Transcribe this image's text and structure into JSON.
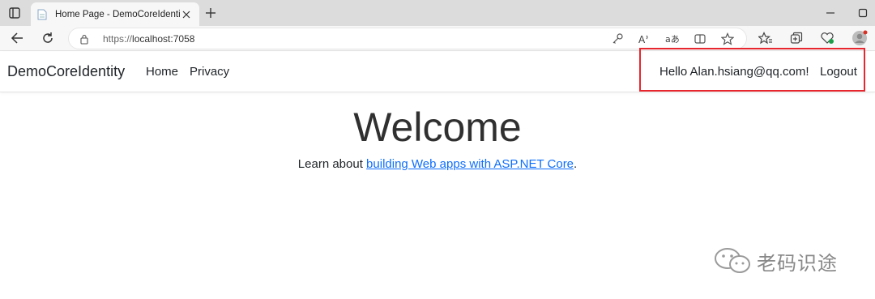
{
  "browser": {
    "tab": {
      "title": "Home Page - DemoCoreIdentity"
    },
    "address": {
      "prefix": "https://",
      "host": "localhost:7058"
    },
    "icons": {
      "tab_actions": "tab-actions-icon",
      "new_tab": "plus-icon",
      "back": "back-arrow-icon",
      "refresh": "refresh-icon",
      "lock": "lock-icon",
      "key": "key-icon",
      "read_aloud": "read-aloud-icon",
      "translate": "translate-icon",
      "split_screen": "split-screen-icon",
      "favorite": "star-icon",
      "favorites_bar": "favorites-icon",
      "collections": "collections-icon",
      "health": "browser-essentials-icon",
      "profile": "profile-icon"
    }
  },
  "site": {
    "brand": "DemoCoreIdentity",
    "nav": {
      "home": "Home",
      "privacy": "Privacy"
    },
    "user": {
      "hello": "Hello Alan.hsiang@qq.com!",
      "logout": "Logout"
    },
    "highlight_color": "#e8262d",
    "main": {
      "heading": "Welcome",
      "learn_prefix": "Learn about ",
      "learn_link": "building Web apps with ASP.NET Core",
      "learn_suffix": "."
    }
  },
  "watermark": {
    "text": "老码识途"
  }
}
